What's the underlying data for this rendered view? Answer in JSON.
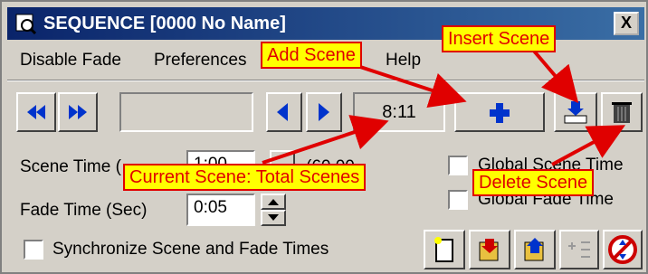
{
  "window": {
    "title": "SEQUENCE [0000 No Name]",
    "close_label": "X"
  },
  "menu": {
    "items": [
      "Disable Fade",
      "Preferences",
      "Help"
    ]
  },
  "toolbar": {
    "scene_counter": "8:11"
  },
  "form": {
    "scene_time_label": "Scene Time (",
    "scene_time_value": "1:00",
    "scene_time_hint": "(60.00 ",
    "fade_time_label": "Fade Time (Sec)",
    "fade_time_value": "0:05",
    "global_scene_time_label": "Global Scene Time",
    "global_fade_time_label": "Global Fade Time",
    "sync_label": "Synchronize Scene and Fade Times"
  },
  "callouts": {
    "add_scene": "Add Scene",
    "insert_scene": "Insert Scene",
    "current_scene": "Current Scene: Total Scenes",
    "delete_scene": "Delete Scene"
  },
  "colors": {
    "titlebar": "#0a246a",
    "callout_fill": "#ffff00",
    "callout_text": "#e00000",
    "nav_icon": "#0033cc"
  }
}
